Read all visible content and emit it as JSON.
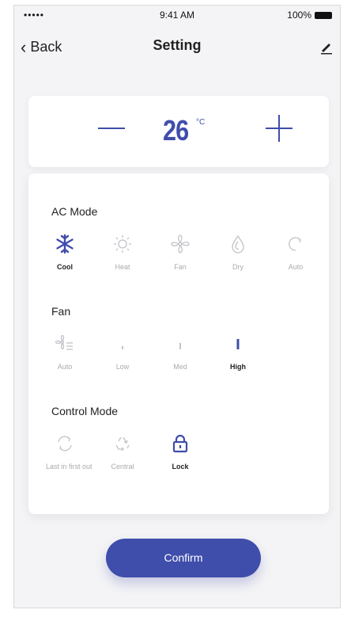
{
  "status_bar": {
    "signal": "••••• ",
    "time": "9:41 AM",
    "battery": "100%"
  },
  "nav": {
    "back_label": "Back",
    "title": "Setting",
    "edit_icon": "pencil-icon"
  },
  "temperature": {
    "value": "26",
    "unit": "°C"
  },
  "ac_mode": {
    "title": "AC Mode",
    "options": [
      {
        "label": "Cool",
        "icon": "snowflake-icon",
        "selected": true
      },
      {
        "label": "Heat",
        "icon": "sun-icon",
        "selected": false
      },
      {
        "label": "Fan",
        "icon": "fan-icon",
        "selected": false
      },
      {
        "label": "Dry",
        "icon": "droplet-icon",
        "selected": false
      },
      {
        "label": "Auto",
        "icon": "auto-icon",
        "selected": false
      }
    ]
  },
  "fan": {
    "title": "Fan",
    "options": [
      {
        "label": "Auto",
        "icon": "fan-auto-icon",
        "selected": false
      },
      {
        "label": "Low",
        "icon": "fan-low-icon",
        "selected": false
      },
      {
        "label": "Med",
        "icon": "fan-med-icon",
        "selected": false
      },
      {
        "label": "High",
        "icon": "fan-high-icon",
        "selected": true
      }
    ]
  },
  "control_mode": {
    "title": "Control Mode",
    "options": [
      {
        "label": "Last in first out",
        "icon": "refresh-icon",
        "selected": false
      },
      {
        "label": "Central",
        "icon": "recycle-icon",
        "selected": false
      },
      {
        "label": "Lock",
        "icon": "lock-icon",
        "selected": true
      }
    ]
  },
  "confirm_label": "Confirm",
  "colors": {
    "accent": "#3f4dab",
    "inactive": "#c2c2c8",
    "background": "#f4f4f6"
  }
}
